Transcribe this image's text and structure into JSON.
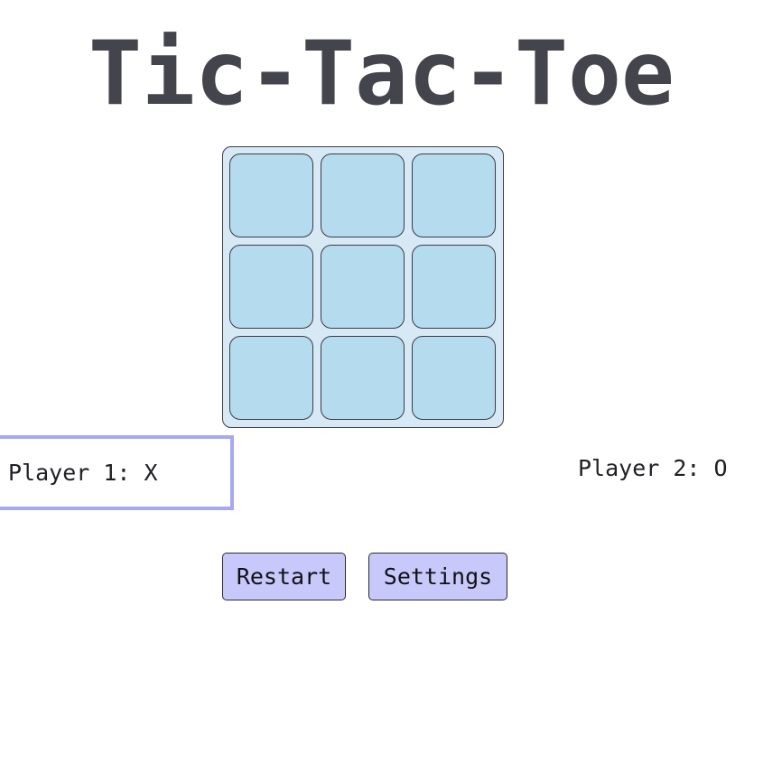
{
  "title": "Tic-Tac-Toe",
  "board": {
    "cells": [
      "",
      "",
      "",
      "",
      "",
      "",
      "",
      "",
      ""
    ]
  },
  "players": {
    "player1": "Player 1: X",
    "player2": "Player 2: O",
    "active": "player1"
  },
  "buttons": {
    "restart": "Restart",
    "settings": "Settings"
  },
  "colors": {
    "title": "#44444c",
    "board_bg": "#d6e9f5",
    "cell_bg": "#b5dbef",
    "button_bg": "#c8c8fb",
    "active_player_border": "#a8a8f2"
  }
}
